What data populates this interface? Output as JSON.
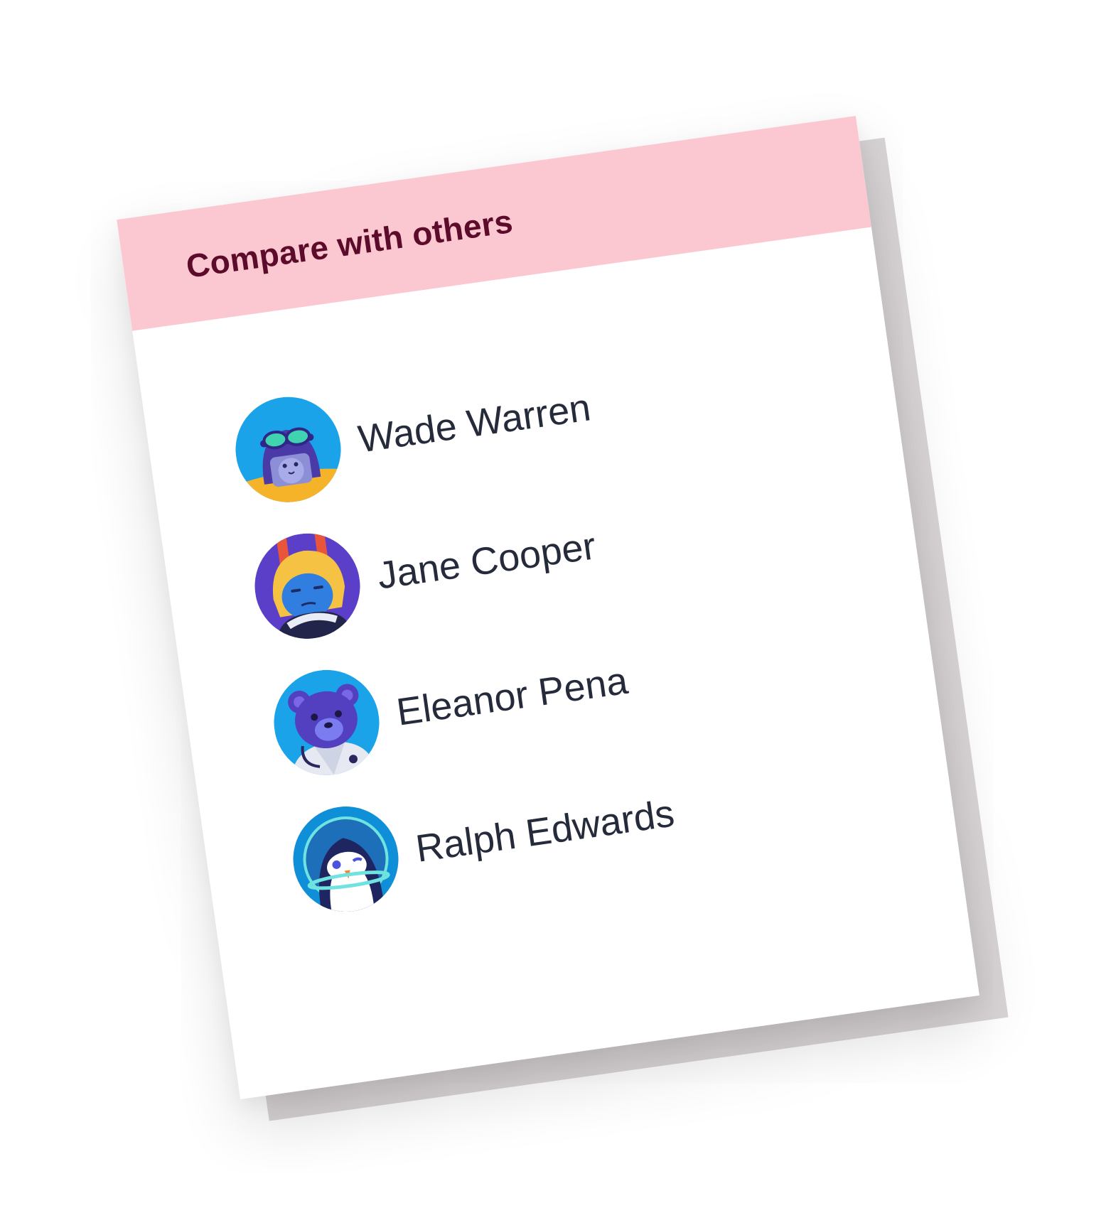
{
  "panel": {
    "title": "Compare with others"
  },
  "people": [
    {
      "name": "Wade Warren",
      "avatar_icon": "pilot-helmet-avatar-icon"
    },
    {
      "name": "Jane Cooper",
      "avatar_icon": "blonde-driver-avatar-icon"
    },
    {
      "name": "Eleanor Pena",
      "avatar_icon": "doctor-bear-avatar-icon"
    },
    {
      "name": "Ralph Edwards",
      "avatar_icon": "astronaut-penguin-avatar-icon"
    }
  ],
  "colors": {
    "header_bg": "#fbc8d2",
    "title_text": "#5c0b2b",
    "name_text": "#252b3a",
    "back_plate": "#d9d4d6"
  }
}
